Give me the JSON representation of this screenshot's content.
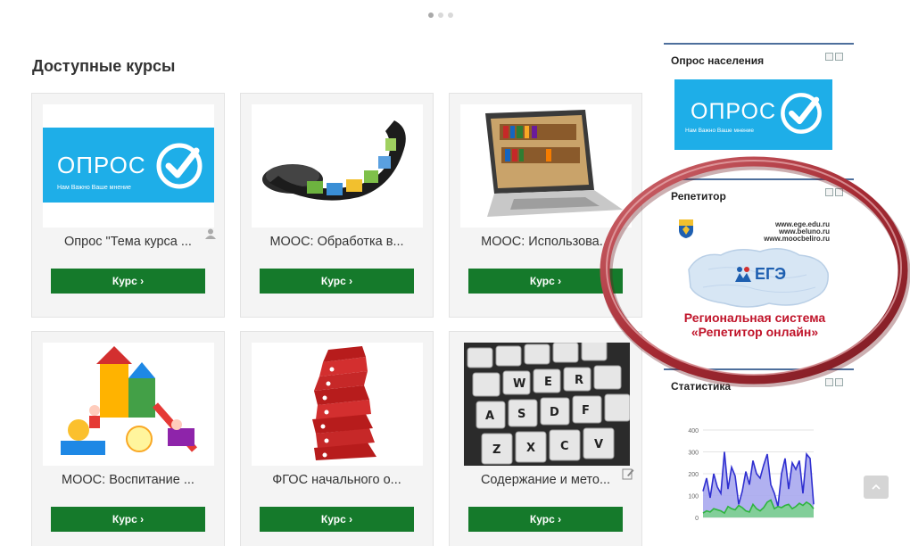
{
  "section_title": "Доступные курсы",
  "course_button_label": "Курс ›",
  "courses": [
    {
      "title": "Опрос \"Тема курса ..."
    },
    {
      "title": "МООС: Обработка в..."
    },
    {
      "title": "МООС: Использова..."
    },
    {
      "title": "МООС: Воспитание ..."
    },
    {
      "title": "ФГОС начального о..."
    },
    {
      "title": "Содержание и мето..."
    }
  ],
  "opros_banner": {
    "word": "ОПРОС",
    "sub": "Нам Важно Ваше мнение"
  },
  "sidebar": {
    "survey": {
      "title": "Опрос населения"
    },
    "tutor": {
      "title": "Репетитор",
      "urls": [
        "www.ege.edu.ru",
        "www.beluno.ru",
        "www.moocbeliro.ru"
      ],
      "ege_label": "ЕГЭ",
      "caption_line1": "Региональная система",
      "caption_line2": "«Репетитор онлайн»"
    },
    "stats": {
      "title": "Статистика"
    }
  },
  "chart_data": {
    "type": "area",
    "yticks": [
      0,
      100,
      200,
      300,
      400
    ],
    "ylim": [
      0,
      400
    ],
    "grid": true,
    "legend": "none",
    "series": [
      {
        "values": [
          120,
          180,
          90,
          200,
          140,
          110,
          300,
          130,
          230,
          190,
          60,
          120,
          210,
          150,
          260,
          200,
          180,
          240,
          290,
          150,
          110,
          50,
          200,
          270,
          130,
          250,
          220,
          260,
          110,
          290,
          270,
          60
        ],
        "color": "#2f2fd0",
        "fill": "#a9a9ee"
      },
      {
        "values": [
          20,
          30,
          25,
          40,
          35,
          30,
          20,
          50,
          40,
          35,
          55,
          45,
          30,
          25,
          60,
          40,
          30,
          45,
          70,
          80,
          40,
          50,
          45,
          55,
          60,
          40,
          50,
          65,
          55,
          70,
          60,
          40
        ],
        "color": "#2fb53f",
        "fill": "#7ad489"
      }
    ],
    "colors": {
      "accent": "#157a2b",
      "banner": "#1eaee8",
      "header_rule": "#4e6f9c",
      "ring": "#a8333a"
    }
  }
}
